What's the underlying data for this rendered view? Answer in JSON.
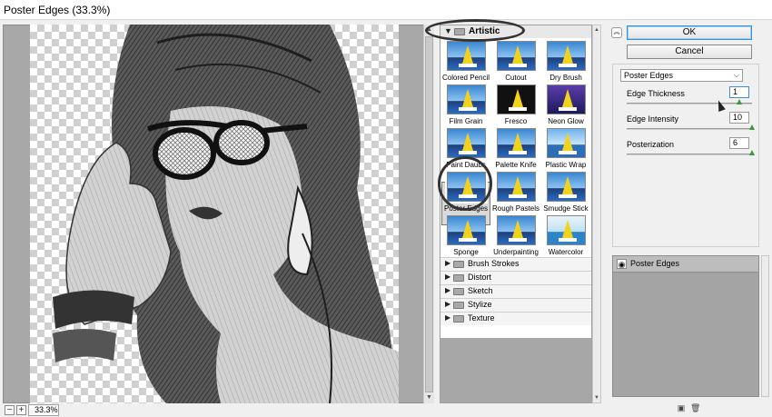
{
  "window": {
    "title": "Poster Edges (33.3%)"
  },
  "preview": {
    "zoom_value": "33.3%",
    "zoom_out_label": "−",
    "zoom_in_label": "+"
  },
  "gallery": {
    "open_category": "Artistic",
    "filters": [
      {
        "name": "Colored Pencil"
      },
      {
        "name": "Cutout"
      },
      {
        "name": "Dry Brush"
      },
      {
        "name": "Film Grain"
      },
      {
        "name": "Fresco"
      },
      {
        "name": "Neon Glow"
      },
      {
        "name": "Paint Daubs"
      },
      {
        "name": "Palette Knife"
      },
      {
        "name": "Plastic Wrap"
      },
      {
        "name": "Poster Edges"
      },
      {
        "name": "Rough Pastels"
      },
      {
        "name": "Smudge Stick"
      },
      {
        "name": "Sponge"
      },
      {
        "name": "Underpainting"
      },
      {
        "name": "Watercolor"
      }
    ],
    "selected_filter": "Poster Edges",
    "categories": [
      "Brush Strokes",
      "Distort",
      "Sketch",
      "Stylize",
      "Texture"
    ]
  },
  "buttons": {
    "ok": "OK",
    "cancel": "Cancel"
  },
  "settings": {
    "filter_select": "Poster Edges",
    "params": [
      {
        "label": "Edge Thickness",
        "value": "1",
        "fraction": 0.9
      },
      {
        "label": "Edge Intensity",
        "value": "10",
        "fraction": 1.0
      },
      {
        "label": "Posterization",
        "value": "6",
        "fraction": 1.0
      }
    ]
  },
  "layers": {
    "items": [
      {
        "label": "Poster Edges"
      }
    ]
  },
  "colors": {
    "accent": "#3b8ed8",
    "slider_knob": "#3a9a3a",
    "panel_gray": "#a4a4a4"
  },
  "icons": {
    "collapse": "double-chevron-up-icon",
    "eye": "eye-icon",
    "new_layer": "new-layer-icon",
    "delete_layer": "trash-icon"
  }
}
